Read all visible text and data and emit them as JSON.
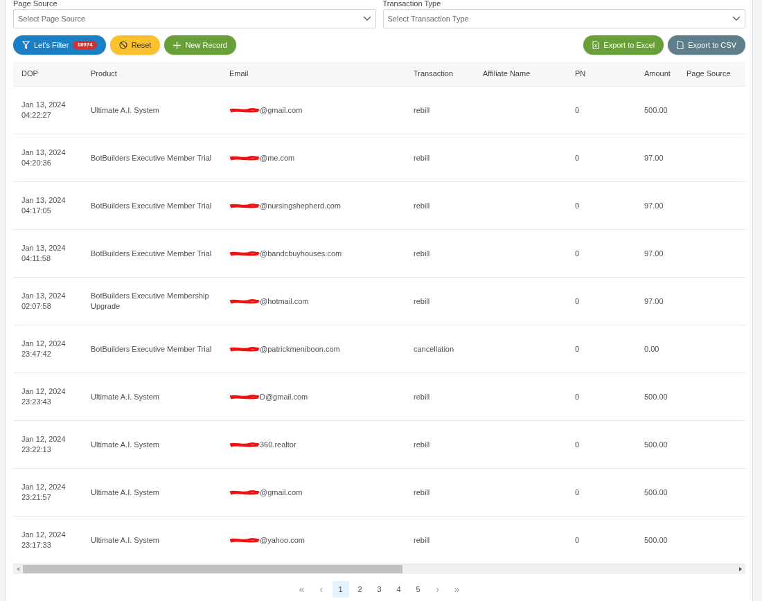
{
  "filters": [
    {
      "label": "Page Source",
      "placeholder": "Select Page Source"
    },
    {
      "label": "Transaction Type",
      "placeholder": "Select Transaction Type"
    }
  ],
  "actions": [
    {
      "kind": "filter",
      "label": "Let's Filter",
      "badge": "18974"
    },
    {
      "kind": "reset",
      "label": "Reset"
    },
    {
      "kind": "new",
      "label": "New Record"
    }
  ],
  "exports": [
    {
      "kind": "excel",
      "label": "Export to Excel"
    },
    {
      "kind": "csv",
      "label": "Export to CSV"
    }
  ],
  "table": {
    "columns": [
      "DOP",
      "Product",
      "Email",
      "Transaction",
      "Affiliate Name",
      "PN",
      "Amount",
      "Page Source"
    ],
    "rows": [
      {
        "date": "Jan 13, 2024",
        "time": "04:22:27",
        "product": "Ultimate A.I. System",
        "email": "@gmail.com",
        "transaction": "rebill",
        "pn": "0",
        "amount": "500.00"
      },
      {
        "date": "Jan 13, 2024",
        "time": "04:20:36",
        "product": "BotBuilders Executive Member Trial",
        "email": "@me.com",
        "transaction": "rebill",
        "pn": "0",
        "amount": "97.00"
      },
      {
        "date": "Jan 13, 2024",
        "time": "04:17:05",
        "product": "BotBuilders Executive Member Trial",
        "email": "@nursingshepherd.com",
        "transaction": "rebill",
        "pn": "0",
        "amount": "97.00"
      },
      {
        "date": "Jan 13, 2024",
        "time": "04:11:58",
        "product": "BotBuilders Executive Member Trial",
        "email": "@bandcbuyhouses.com",
        "transaction": "rebill",
        "pn": "0",
        "amount": "97.00"
      },
      {
        "date": "Jan 13, 2024",
        "time": "02:07:58",
        "product": "BotBuilders Executive Membership Upgrade",
        "email": "@hotmail.com",
        "transaction": "rebill",
        "pn": "0",
        "amount": "97.00"
      },
      {
        "date": "Jan 12, 2024",
        "time": "23:47:42",
        "product": "BotBuilders Executive Member Trial",
        "email": "@patrickmeniboon.com",
        "transaction": "cancellation",
        "pn": "0",
        "amount": "0.00"
      },
      {
        "date": "Jan 12, 2024",
        "time": "23:23:43",
        "product": "Ultimate A.I. System",
        "email": "D@gmail.com",
        "transaction": "rebill",
        "pn": "0",
        "amount": "500.00"
      },
      {
        "date": "Jan 12, 2024",
        "time": "23:22:13",
        "product": "Ultimate A.I. System",
        "email": "360.realtor",
        "transaction": "rebill",
        "pn": "0",
        "amount": "500.00"
      },
      {
        "date": "Jan 12, 2024",
        "time": "23:21:57",
        "product": "Ultimate A.I. System",
        "email": "@gmail.com",
        "transaction": "rebill",
        "pn": "0",
        "amount": "500.00"
      },
      {
        "date": "Jan 12, 2024",
        "time": "23:17:33",
        "product": "Ultimate A.I. System",
        "email": "@yahoo.com",
        "transaction": "rebill",
        "pn": "0",
        "amount": "500.00"
      }
    ]
  },
  "pagination": [
    {
      "kind": "first",
      "label": "«"
    },
    {
      "kind": "prev",
      "label": "‹"
    },
    {
      "kind": "page",
      "label": "1",
      "selected": true
    },
    {
      "kind": "page",
      "label": "2",
      "selected": false
    },
    {
      "kind": "page",
      "label": "3",
      "selected": false
    },
    {
      "kind": "page",
      "label": "4",
      "selected": false
    },
    {
      "kind": "page",
      "label": "5",
      "selected": false
    },
    {
      "kind": "next",
      "label": "›"
    },
    {
      "kind": "last",
      "label": "»"
    }
  ]
}
